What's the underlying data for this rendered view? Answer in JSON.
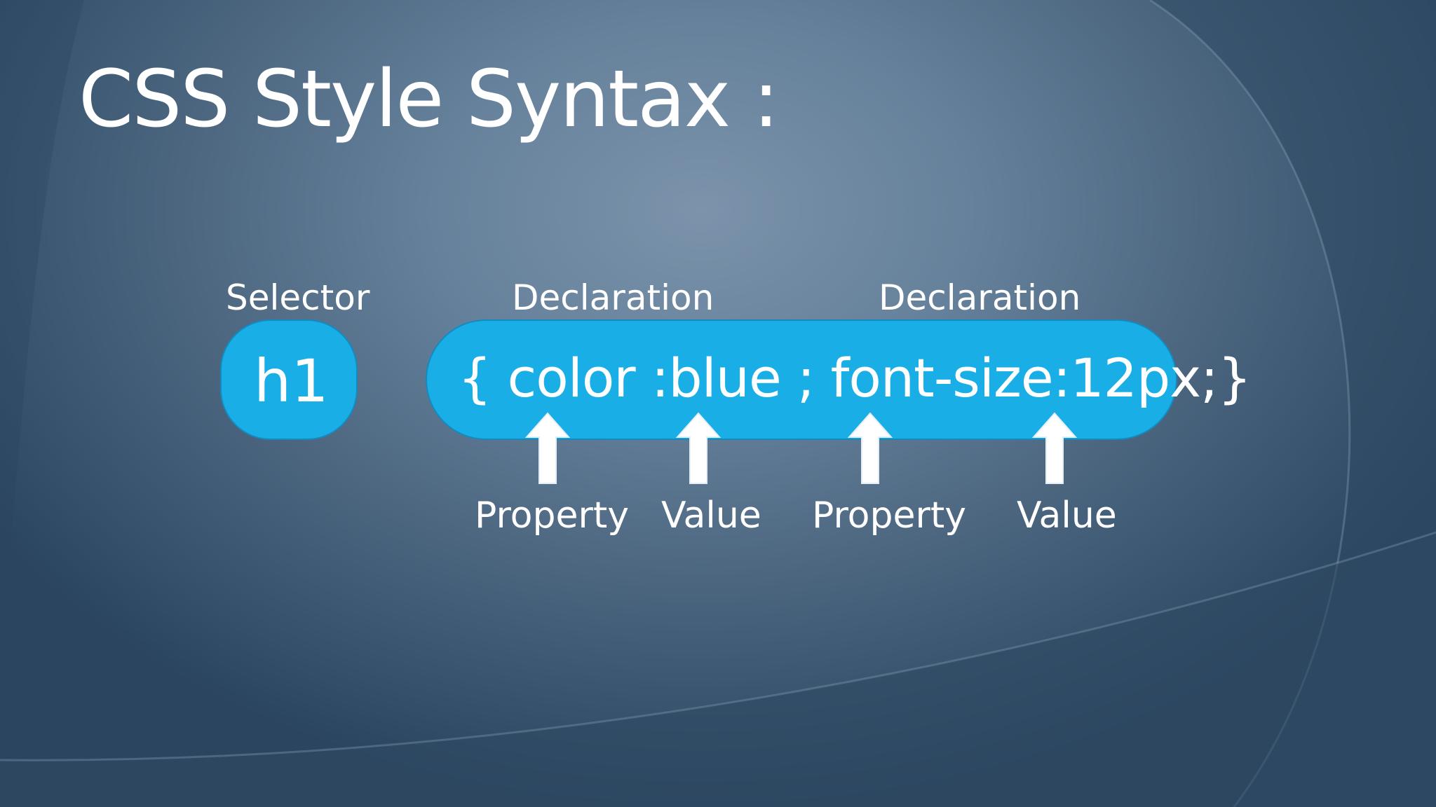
{
  "slide": {
    "title": "CSS Style Syntax :",
    "headers": {
      "selector": "Selector",
      "declaration_1": "Declaration",
      "declaration_2": "Declaration"
    },
    "selector_code": "h1",
    "declaration_code": "{ color :blue ; font-size:12px;}",
    "labels": {
      "property_1": "Property",
      "value_1": "Value",
      "property_2": "Property",
      "value_2": "Value"
    }
  },
  "colors": {
    "pill_fill": "#1aaee6",
    "pill_border": "#128cc0",
    "text": "#ffffff",
    "background_center": "#7b93ab",
    "background_edge": "#2b4560"
  }
}
